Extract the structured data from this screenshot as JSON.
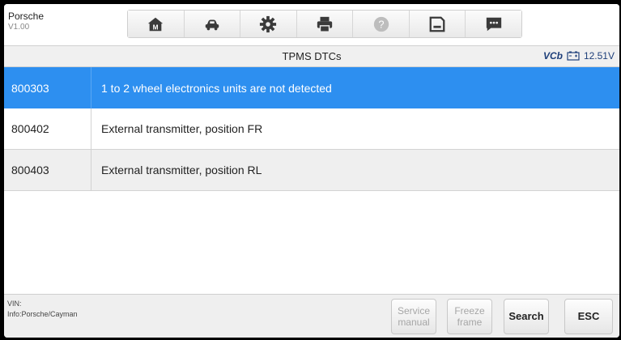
{
  "vehicle": {
    "make": "Porsche",
    "version": "V1.00"
  },
  "toolbar": {
    "icons": [
      "home-icon",
      "vehicle-menu-icon",
      "settings-icon",
      "print-icon",
      "help-icon",
      "save-icon",
      "message-icon"
    ]
  },
  "title": "TPMS DTCs",
  "status": {
    "vci": "VCb",
    "voltage": "12.51V"
  },
  "dtcs": [
    {
      "code": "800303",
      "description": "1 to 2 wheel electronics units are not detected"
    },
    {
      "code": "800402",
      "description": "External transmitter, position FR"
    },
    {
      "code": "800403",
      "description": "External transmitter, position RL"
    }
  ],
  "footer": {
    "vin_label": "VIN:",
    "info": "Info:Porsche/Cayman",
    "buttons": {
      "service_manual": "Service manual",
      "freeze_frame": "Freeze frame",
      "search": "Search",
      "esc": "ESC"
    }
  },
  "colors": {
    "selected_row": "#2d8ff0",
    "accent_text": "#1e3f7a"
  }
}
